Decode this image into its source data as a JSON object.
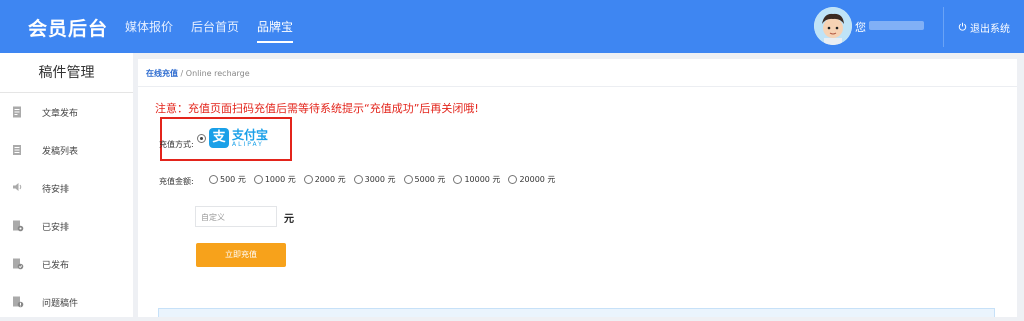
{
  "header": {
    "brand": "会员后台",
    "nav": [
      "媒体报价",
      "后台首页",
      "品牌宝"
    ],
    "greeting": "您",
    "logout": "退出系统"
  },
  "sidebar": {
    "title": "稿件管理",
    "items": [
      {
        "label": "文章发布",
        "icon": "document-icon"
      },
      {
        "label": "发稿列表",
        "icon": "list-icon"
      },
      {
        "label": "待安排",
        "icon": "speaker-icon"
      },
      {
        "label": "已安排",
        "icon": "doc-gear-icon"
      },
      {
        "label": "已发布",
        "icon": "doc-check-icon"
      },
      {
        "label": "问题稿件",
        "icon": "doc-warning-icon"
      }
    ]
  },
  "breadcrumb": {
    "main": "在线充值",
    "sep": " / ",
    "sub": "Online recharge"
  },
  "notice": "注意：充值页面扫码充值后需等待系统提示“充值成功”后再关闭哦!",
  "payment": {
    "method_label": "充值方式:",
    "alipay_cn": "支付宝",
    "alipay_en": "ALIPAY",
    "amount_label": "充值金额:",
    "amounts": [
      "500 元",
      "1000 元",
      "2000 元",
      "3000 元",
      "5000 元",
      "10000 元",
      "20000 元"
    ],
    "custom_placeholder": "自定义",
    "unit": "元",
    "submit": "立即充值"
  },
  "colors": {
    "header_bg": "#3e86f2",
    "notice": "#e3241b",
    "submit_bg": "#f7a21b",
    "alipay": "#1aa0e8"
  }
}
